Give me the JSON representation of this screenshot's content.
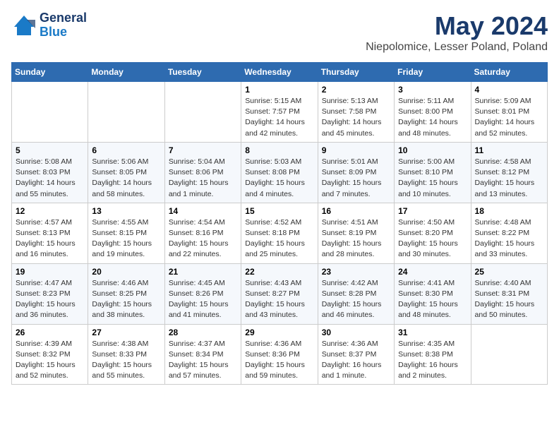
{
  "header": {
    "logo_general": "General",
    "logo_blue": "Blue",
    "title": "May 2024",
    "location": "Niepolomice, Lesser Poland, Poland"
  },
  "weekdays": [
    "Sunday",
    "Monday",
    "Tuesday",
    "Wednesday",
    "Thursday",
    "Friday",
    "Saturday"
  ],
  "weeks": [
    [
      {
        "day": "",
        "info": ""
      },
      {
        "day": "",
        "info": ""
      },
      {
        "day": "",
        "info": ""
      },
      {
        "day": "1",
        "info": "Sunrise: 5:15 AM\nSunset: 7:57 PM\nDaylight: 14 hours\nand 42 minutes."
      },
      {
        "day": "2",
        "info": "Sunrise: 5:13 AM\nSunset: 7:58 PM\nDaylight: 14 hours\nand 45 minutes."
      },
      {
        "day": "3",
        "info": "Sunrise: 5:11 AM\nSunset: 8:00 PM\nDaylight: 14 hours\nand 48 minutes."
      },
      {
        "day": "4",
        "info": "Sunrise: 5:09 AM\nSunset: 8:01 PM\nDaylight: 14 hours\nand 52 minutes."
      }
    ],
    [
      {
        "day": "5",
        "info": "Sunrise: 5:08 AM\nSunset: 8:03 PM\nDaylight: 14 hours\nand 55 minutes."
      },
      {
        "day": "6",
        "info": "Sunrise: 5:06 AM\nSunset: 8:05 PM\nDaylight: 14 hours\nand 58 minutes."
      },
      {
        "day": "7",
        "info": "Sunrise: 5:04 AM\nSunset: 8:06 PM\nDaylight: 15 hours\nand 1 minute."
      },
      {
        "day": "8",
        "info": "Sunrise: 5:03 AM\nSunset: 8:08 PM\nDaylight: 15 hours\nand 4 minutes."
      },
      {
        "day": "9",
        "info": "Sunrise: 5:01 AM\nSunset: 8:09 PM\nDaylight: 15 hours\nand 7 minutes."
      },
      {
        "day": "10",
        "info": "Sunrise: 5:00 AM\nSunset: 8:10 PM\nDaylight: 15 hours\nand 10 minutes."
      },
      {
        "day": "11",
        "info": "Sunrise: 4:58 AM\nSunset: 8:12 PM\nDaylight: 15 hours\nand 13 minutes."
      }
    ],
    [
      {
        "day": "12",
        "info": "Sunrise: 4:57 AM\nSunset: 8:13 PM\nDaylight: 15 hours\nand 16 minutes."
      },
      {
        "day": "13",
        "info": "Sunrise: 4:55 AM\nSunset: 8:15 PM\nDaylight: 15 hours\nand 19 minutes."
      },
      {
        "day": "14",
        "info": "Sunrise: 4:54 AM\nSunset: 8:16 PM\nDaylight: 15 hours\nand 22 minutes."
      },
      {
        "day": "15",
        "info": "Sunrise: 4:52 AM\nSunset: 8:18 PM\nDaylight: 15 hours\nand 25 minutes."
      },
      {
        "day": "16",
        "info": "Sunrise: 4:51 AM\nSunset: 8:19 PM\nDaylight: 15 hours\nand 28 minutes."
      },
      {
        "day": "17",
        "info": "Sunrise: 4:50 AM\nSunset: 8:20 PM\nDaylight: 15 hours\nand 30 minutes."
      },
      {
        "day": "18",
        "info": "Sunrise: 4:48 AM\nSunset: 8:22 PM\nDaylight: 15 hours\nand 33 minutes."
      }
    ],
    [
      {
        "day": "19",
        "info": "Sunrise: 4:47 AM\nSunset: 8:23 PM\nDaylight: 15 hours\nand 36 minutes."
      },
      {
        "day": "20",
        "info": "Sunrise: 4:46 AM\nSunset: 8:25 PM\nDaylight: 15 hours\nand 38 minutes."
      },
      {
        "day": "21",
        "info": "Sunrise: 4:45 AM\nSunset: 8:26 PM\nDaylight: 15 hours\nand 41 minutes."
      },
      {
        "day": "22",
        "info": "Sunrise: 4:43 AM\nSunset: 8:27 PM\nDaylight: 15 hours\nand 43 minutes."
      },
      {
        "day": "23",
        "info": "Sunrise: 4:42 AM\nSunset: 8:28 PM\nDaylight: 15 hours\nand 46 minutes."
      },
      {
        "day": "24",
        "info": "Sunrise: 4:41 AM\nSunset: 8:30 PM\nDaylight: 15 hours\nand 48 minutes."
      },
      {
        "day": "25",
        "info": "Sunrise: 4:40 AM\nSunset: 8:31 PM\nDaylight: 15 hours\nand 50 minutes."
      }
    ],
    [
      {
        "day": "26",
        "info": "Sunrise: 4:39 AM\nSunset: 8:32 PM\nDaylight: 15 hours\nand 52 minutes."
      },
      {
        "day": "27",
        "info": "Sunrise: 4:38 AM\nSunset: 8:33 PM\nDaylight: 15 hours\nand 55 minutes."
      },
      {
        "day": "28",
        "info": "Sunrise: 4:37 AM\nSunset: 8:34 PM\nDaylight: 15 hours\nand 57 minutes."
      },
      {
        "day": "29",
        "info": "Sunrise: 4:36 AM\nSunset: 8:36 PM\nDaylight: 15 hours\nand 59 minutes."
      },
      {
        "day": "30",
        "info": "Sunrise: 4:36 AM\nSunset: 8:37 PM\nDaylight: 16 hours\nand 1 minute."
      },
      {
        "day": "31",
        "info": "Sunrise: 4:35 AM\nSunset: 8:38 PM\nDaylight: 16 hours\nand 2 minutes."
      },
      {
        "day": "",
        "info": ""
      }
    ]
  ]
}
